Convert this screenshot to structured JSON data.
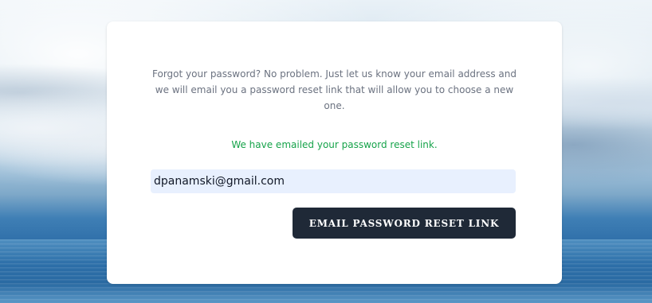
{
  "reset_form": {
    "intro_text": "Forgot your password? No problem. Just let us know your email address and we will email you a password reset link that will allow you to choose a new one.",
    "status_message": "We have emailed your password reset link.",
    "email_value": "dpanamski@gmail.com",
    "submit_label": "EMAIL PASSWORD RESET LINK"
  },
  "colors": {
    "card_background": "#ffffff",
    "status_text": "#16a34a",
    "button_background": "#1f2937",
    "input_background": "#e8f0fe"
  }
}
